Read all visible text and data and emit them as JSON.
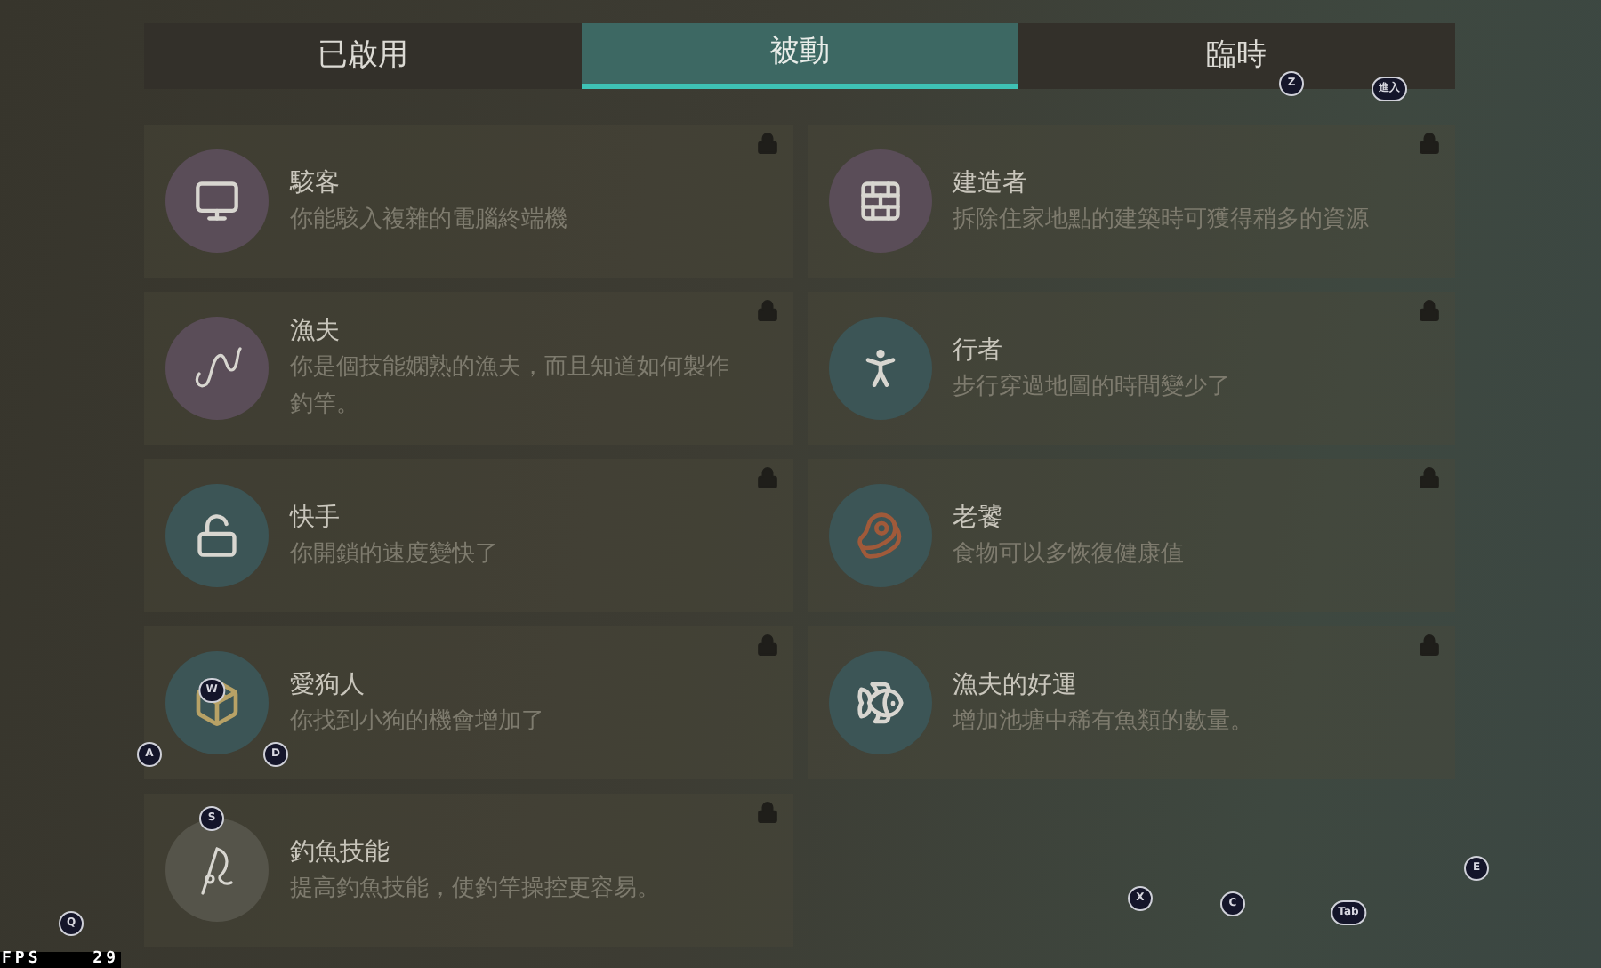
{
  "tabs": [
    {
      "label": "已啟用",
      "selected": false
    },
    {
      "label": "被動",
      "selected": true
    },
    {
      "label": "臨時",
      "selected": false
    }
  ],
  "perks": [
    {
      "title": "駭客",
      "description": "你能駭入複雜的電腦終端機",
      "color": "#5a4d58",
      "locked": true
    },
    {
      "title": "建造者",
      "description": "拆除住家地點的建築時可獲得稍多的資源",
      "color": "#5a4d58",
      "locked": true
    },
    {
      "title": "漁夫",
      "description": "你是個技能嫻熟的漁夫，而且知道如何製作釣竿。",
      "color": "#5a4d58",
      "locked": true
    },
    {
      "title": "行者",
      "description": "步行穿過地圖的時間變少了",
      "color": "#3c5556",
      "locked": true
    },
    {
      "title": "快手",
      "description": "你開鎖的速度變快了",
      "color": "#3c5556",
      "locked": true
    },
    {
      "title": "老饕",
      "description": "食物可以多恢復健康值",
      "color": "#3c5556",
      "locked": true
    },
    {
      "title": "愛狗人",
      "description": "你找到小狗的機會增加了",
      "color": "#3c5556",
      "locked": true
    },
    {
      "title": "漁夫的好運",
      "description": "增加池塘中稀有魚類的數量。",
      "color": "#3c5556",
      "locked": true
    },
    {
      "title": "釣魚技能",
      "description": "提高釣魚技能，使釣竿操控更容易。",
      "color": "#55544a",
      "locked": true
    }
  ],
  "key_hints": [
    "Z",
    "進入",
    "W",
    "A",
    "D",
    "S",
    "Q",
    "X",
    "C",
    "Tab",
    "E"
  ],
  "fps": {
    "label": "FPS",
    "value": "29"
  }
}
